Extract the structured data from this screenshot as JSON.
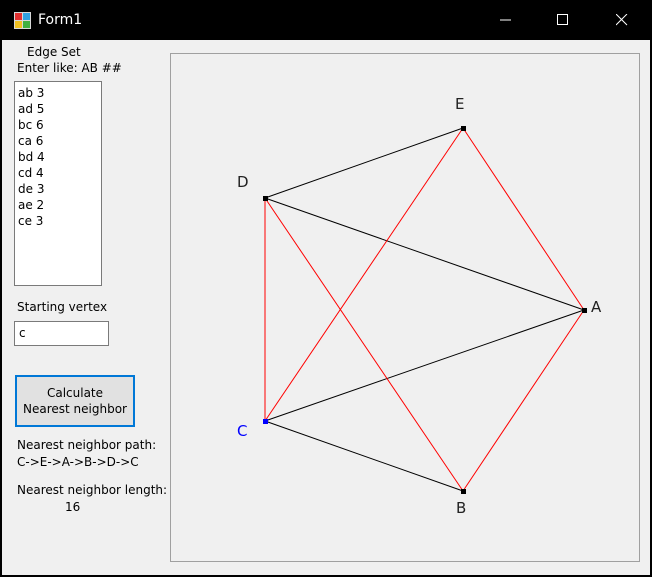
{
  "window": {
    "title": "Form1"
  },
  "left_panel": {
    "edge_set_title": "Edge Set",
    "edge_set_hint": "Enter like: AB ##",
    "edges_text": "ab 3\nad 5\nbc 6\nca 6\nbd 4\ncd 4\nde 3\nae 2\nce 3",
    "starting_vertex_label": "Starting vertex",
    "starting_vertex_value": "c",
    "calc_button_line1": "Calculate",
    "calc_button_line2": "Nearest neighbor",
    "path_label": "Nearest neighbor path:",
    "path_value": "C->E->A->B->D->C",
    "length_label": "Nearest neighbor length:",
    "length_value": "16"
  },
  "graph": {
    "vertices": {
      "A": "A",
      "B": "B",
      "C": "C",
      "D": "D",
      "E": "E"
    },
    "edges": [
      {
        "from": "A",
        "to": "B",
        "color": "#ff0000"
      },
      {
        "from": "A",
        "to": "D",
        "color": "#000000"
      },
      {
        "from": "B",
        "to": "C",
        "color": "#000000"
      },
      {
        "from": "C",
        "to": "A",
        "color": "#000000"
      },
      {
        "from": "B",
        "to": "D",
        "color": "#ff0000"
      },
      {
        "from": "C",
        "to": "D",
        "color": "#ff0000"
      },
      {
        "from": "D",
        "to": "E",
        "color": "#000000"
      },
      {
        "from": "A",
        "to": "E",
        "color": "#ff0000"
      },
      {
        "from": "C",
        "to": "E",
        "color": "#ff0000"
      }
    ],
    "start_vertex_color": "#0000ff",
    "vertex_color": "#000000"
  }
}
